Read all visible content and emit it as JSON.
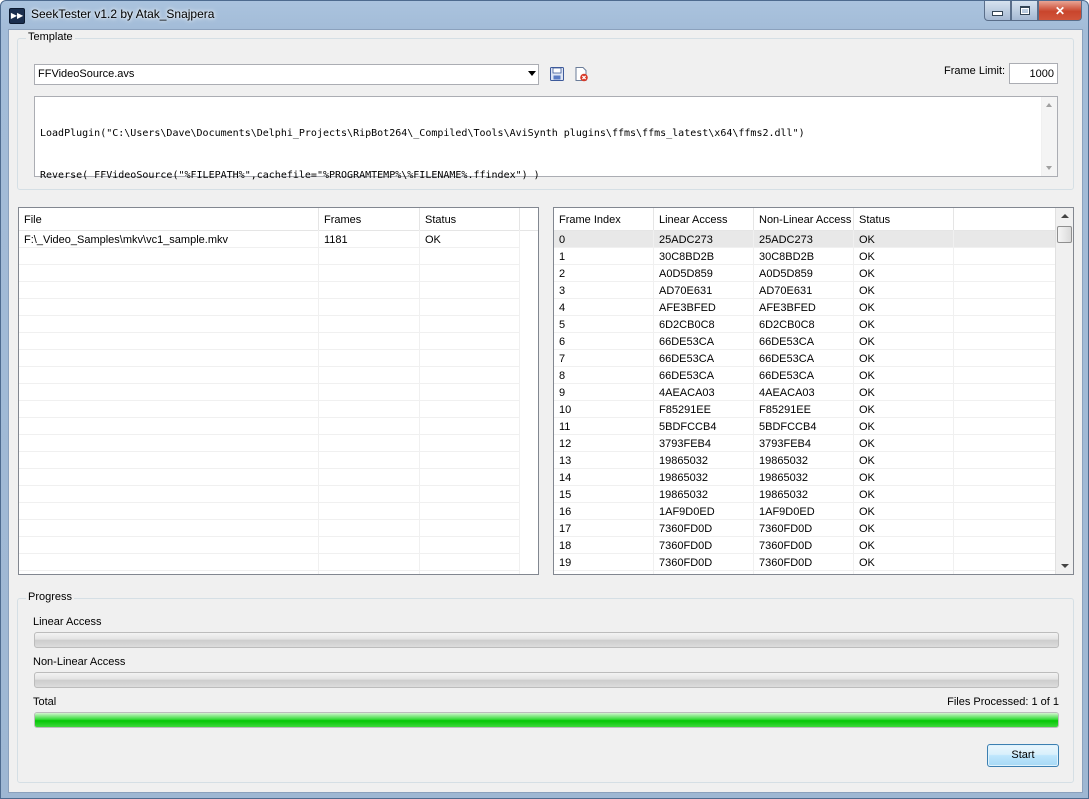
{
  "window": {
    "title": "SeekTester v1.2 by Atak_Snajpera"
  },
  "template": {
    "group_label": "Template",
    "combo_value": "FFVideoSource.avs",
    "frame_limit_label": "Frame Limit:",
    "frame_limit_value": "1000",
    "script_lines": [
      "LoadPlugin(\"C:\\Users\\Dave\\Documents\\Delphi_Projects\\RipBot264\\_Compiled\\Tools\\AviSynth plugins\\ffms\\ffms_latest\\x64\\ffms2.dll\")",
      "Reverse( FFVideoSource(\"%FILEPATH%\",cachefile=\"%PROGRAMTEMP%\\%FILENAME%.ffindex\") )"
    ]
  },
  "files": {
    "columns": [
      "File",
      "Frames",
      "Status"
    ],
    "rows": [
      [
        "F:\\_Video_Samples\\mkv\\vc1_sample.mkv",
        "1181",
        "OK"
      ]
    ]
  },
  "frames": {
    "columns": [
      "Frame Index",
      "Linear Access",
      "Non-Linear Access",
      "Status"
    ],
    "rows": [
      [
        "0",
        "25ADC273",
        "25ADC273",
        "OK"
      ],
      [
        "1",
        "30C8BD2B",
        "30C8BD2B",
        "OK"
      ],
      [
        "2",
        "A0D5D859",
        "A0D5D859",
        "OK"
      ],
      [
        "3",
        "AD70E631",
        "AD70E631",
        "OK"
      ],
      [
        "4",
        "AFE3BFED",
        "AFE3BFED",
        "OK"
      ],
      [
        "5",
        "6D2CB0C8",
        "6D2CB0C8",
        "OK"
      ],
      [
        "6",
        "66DE53CA",
        "66DE53CA",
        "OK"
      ],
      [
        "7",
        "66DE53CA",
        "66DE53CA",
        "OK"
      ],
      [
        "8",
        "66DE53CA",
        "66DE53CA",
        "OK"
      ],
      [
        "9",
        "4AEACA03",
        "4AEACA03",
        "OK"
      ],
      [
        "10",
        "F85291EE",
        "F85291EE",
        "OK"
      ],
      [
        "11",
        "5BDFCCB4",
        "5BDFCCB4",
        "OK"
      ],
      [
        "12",
        "3793FEB4",
        "3793FEB4",
        "OK"
      ],
      [
        "13",
        "19865032",
        "19865032",
        "OK"
      ],
      [
        "14",
        "19865032",
        "19865032",
        "OK"
      ],
      [
        "15",
        "19865032",
        "19865032",
        "OK"
      ],
      [
        "16",
        "1AF9D0ED",
        "1AF9D0ED",
        "OK"
      ],
      [
        "17",
        "7360FD0D",
        "7360FD0D",
        "OK"
      ],
      [
        "18",
        "7360FD0D",
        "7360FD0D",
        "OK"
      ],
      [
        "19",
        "7360FD0D",
        "7360FD0D",
        "OK"
      ]
    ]
  },
  "progress": {
    "group_label": "Progress",
    "linear_label": "Linear Access",
    "linear_fraction": 0,
    "nonlinear_label": "Non-Linear Access",
    "nonlinear_fraction": 0,
    "total_label": "Total",
    "files_processed": "Files Processed: 1 of 1",
    "total_fraction": 1
  },
  "buttons": {
    "start": "Start"
  },
  "icons": {
    "save": "save-icon",
    "delete": "delete-icon"
  },
  "colors": {
    "progress_green": "#06c706",
    "title_blue": "#a3bcd8"
  }
}
